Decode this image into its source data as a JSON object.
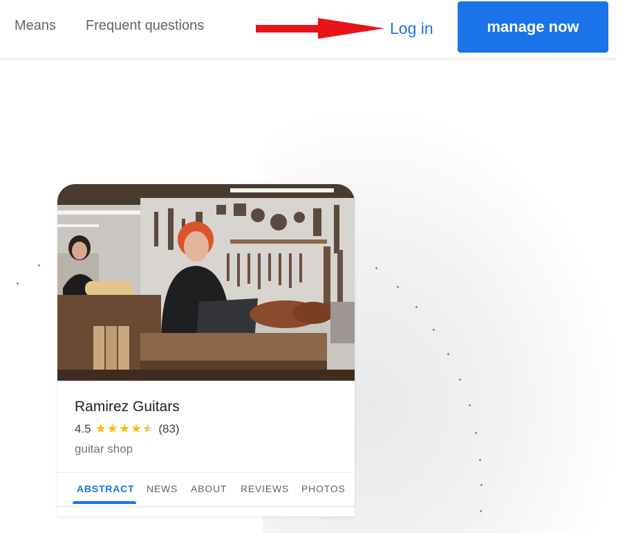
{
  "header": {
    "nav": [
      "Means",
      "Frequent questions"
    ],
    "login_label": "Log in",
    "cta_label": "manage now"
  },
  "colors": {
    "accent": "#1a73e8",
    "arrow": "#e8141a",
    "star": "#fbbc04"
  },
  "business": {
    "name": "Ramirez Guitars",
    "rating": "4.5",
    "rating_value": 4.5,
    "stars": "★★★★",
    "review_count": "(83)",
    "category": "guitar shop",
    "tabs": [
      "ABSTRACT",
      "NEWS",
      "ABOUT",
      "REVIEWS",
      "PHOTOS"
    ],
    "active_tab": "ABSTRACT"
  },
  "icons": {
    "arrow": "red-arrow-icon",
    "star": "star-icon",
    "half_star": "half-star-icon"
  }
}
